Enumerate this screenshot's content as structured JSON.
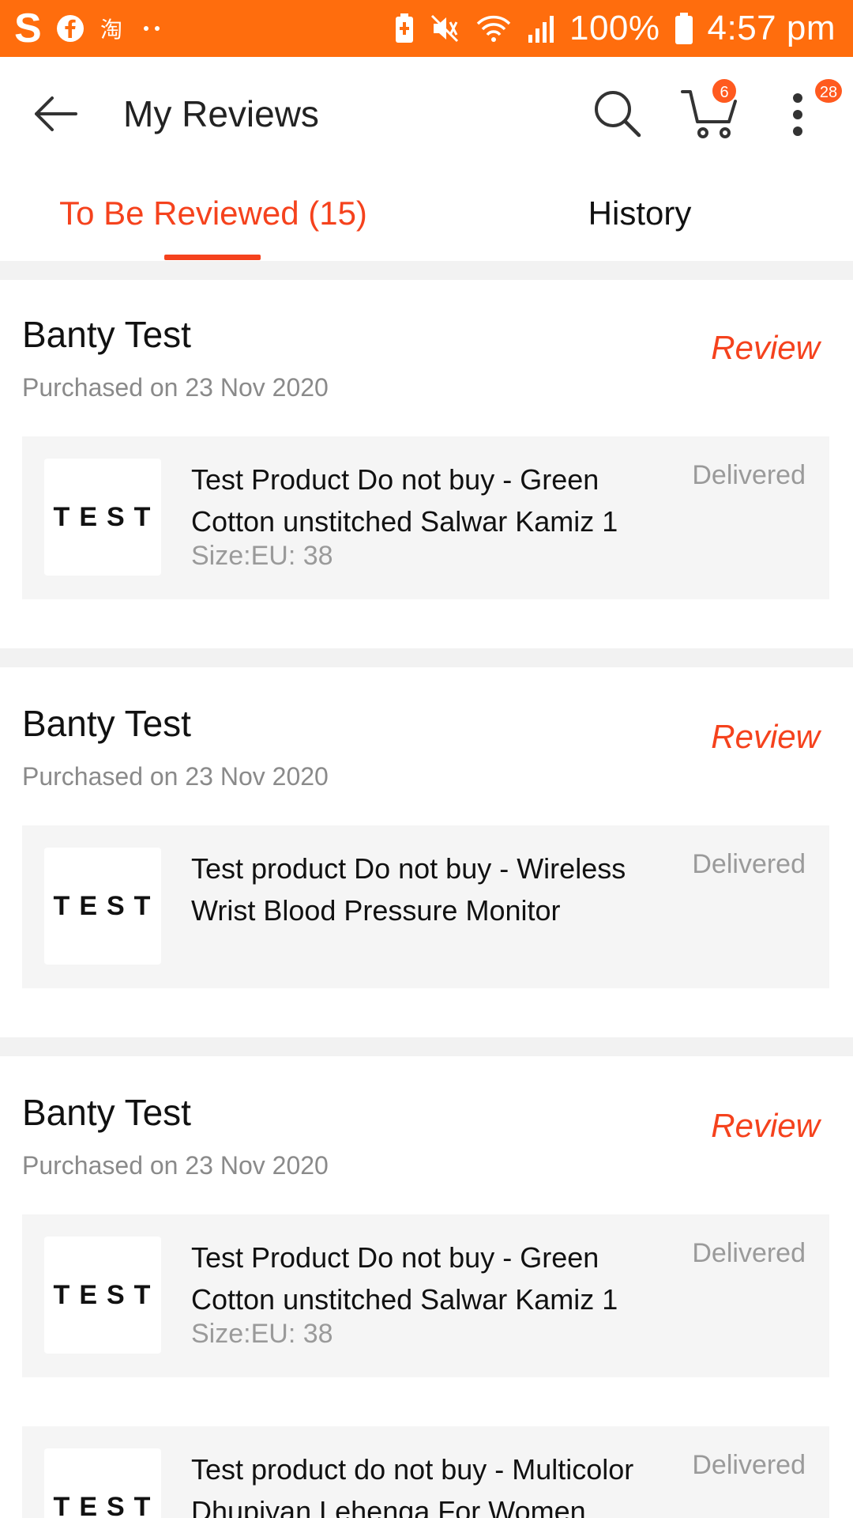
{
  "status_bar": {
    "battery_percent": "100%",
    "time": "4:57 pm",
    "icons": [
      "skype-icon",
      "facebook-icon",
      "taobao-icon",
      "dots-icon",
      "battery-saver-icon",
      "mute-icon",
      "wifi-icon",
      "signal-icon",
      "battery-icon"
    ],
    "color": "#ff6d0d"
  },
  "appbar": {
    "title": "My Reviews",
    "cart_badge": "6",
    "more_badge": "28"
  },
  "tabs": [
    {
      "label": "To Be Reviewed (15)",
      "active": true
    },
    {
      "label": "History",
      "active": false
    }
  ],
  "accent_color": "#f5421d",
  "reviews": [
    {
      "seller": "Banty Test",
      "purchased": "Purchased on 23 Nov 2020",
      "action": "Review",
      "products": [
        {
          "thumb": "TEST",
          "name": "Test Product Do not buy - Green Cotton unstitched Salwar Kamiz 1",
          "size": "Size:EU: 38",
          "status": "Delivered"
        }
      ]
    },
    {
      "seller": "Banty Test",
      "purchased": "Purchased on 23 Nov 2020",
      "action": "Review",
      "products": [
        {
          "thumb": "TEST",
          "name": "Test product Do not buy - Wireless Wrist Blood Pressure Monitor",
          "size": "",
          "status": "Delivered"
        }
      ]
    },
    {
      "seller": "Banty Test",
      "purchased": "Purchased on 23 Nov 2020",
      "action": "Review",
      "products": [
        {
          "thumb": "TEST",
          "name": "Test Product Do not buy - Green Cotton unstitched Salwar Kamiz 1",
          "size": "Size:EU: 38",
          "status": "Delivered"
        },
        {
          "thumb": "TEST",
          "name": "Test product do not buy - Multicolor Dhupiyan Lehenga For Women",
          "size": "",
          "status": "Delivered"
        }
      ]
    }
  ]
}
